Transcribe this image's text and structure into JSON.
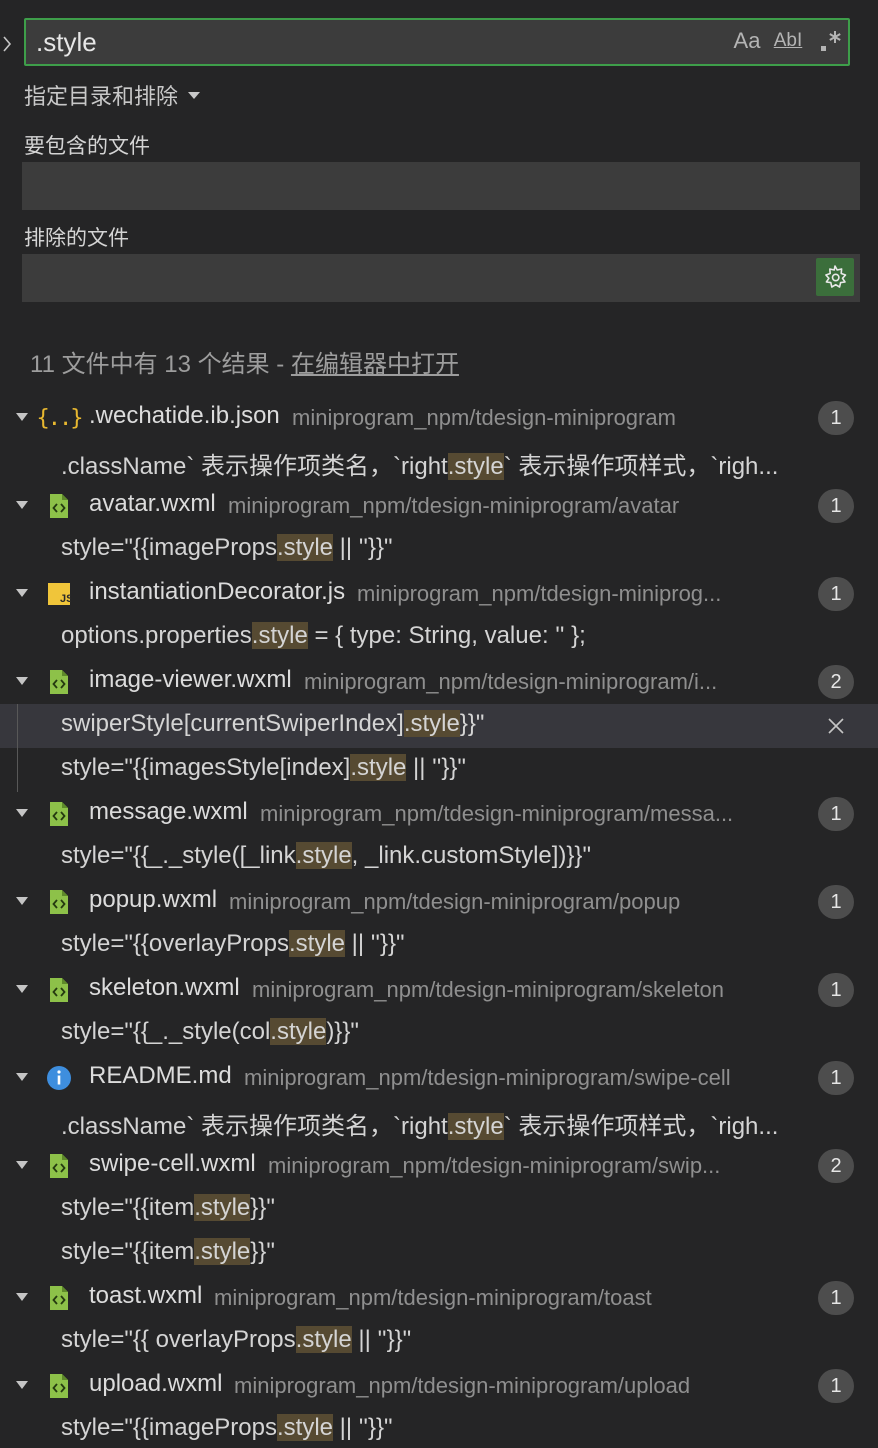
{
  "search": {
    "value": ".style",
    "match_case_label": "Aa",
    "whole_word_label": "AbI",
    "regex_label": ".*"
  },
  "details_toggle_label": "指定目录和排除",
  "include": {
    "label": "要包含的文件",
    "value": ""
  },
  "exclude": {
    "label": "排除的文件",
    "value": ""
  },
  "summary": {
    "text": "11 文件中有 13 个结果 - ",
    "link": "在编辑器中打开"
  },
  "colors": {
    "accent_border": "#3e9e4a",
    "match_highlight": "#564a32"
  },
  "results": [
    {
      "icon": "json-icon",
      "name": ".wechatide.ib.json",
      "path": "miniprogram_npm/tdesign-miniprogram",
      "count": "1",
      "matches": [
        {
          "pre": ".className` 表示操作项类名，`right",
          "hit": ".style",
          "post": "` 表示操作项样式，`righ..."
        }
      ]
    },
    {
      "icon": "wxml-icon",
      "name": "avatar.wxml",
      "path": "miniprogram_npm/tdesign-miniprogram/avatar",
      "count": "1",
      "matches": [
        {
          "pre": "style=\"{{imageProps",
          "hit": ".style",
          "post": " || ''}}\""
        }
      ]
    },
    {
      "icon": "js-icon",
      "name": "instantiationDecorator.js",
      "path": "miniprogram_npm/tdesign-miniprog...",
      "count": "1",
      "matches": [
        {
          "pre": "options.properties",
          "hit": ".style",
          "post": " = { type: String, value: '' };"
        }
      ]
    },
    {
      "icon": "wxml-icon",
      "name": "image-viewer.wxml",
      "path": "miniprogram_npm/tdesign-miniprogram/i...",
      "count": "2",
      "matches": [
        {
          "pre": "swiperStyle[currentSwiperIndex]",
          "hit": ".style",
          "post": "}}\"",
          "selected": true
        },
        {
          "pre": "style=\"{{imagesStyle[index]",
          "hit": ".style",
          "post": " || ''}}\""
        }
      ]
    },
    {
      "icon": "wxml-icon",
      "name": "message.wxml",
      "path": "miniprogram_npm/tdesign-miniprogram/messa...",
      "count": "1",
      "matches": [
        {
          "pre": "style=\"{{_._style([_link",
          "hit": ".style",
          "post": ", _link.customStyle])}}\""
        }
      ]
    },
    {
      "icon": "wxml-icon",
      "name": "popup.wxml",
      "path": "miniprogram_npm/tdesign-miniprogram/popup",
      "count": "1",
      "matches": [
        {
          "pre": "style=\"{{overlayProps",
          "hit": ".style",
          "post": " || ''}}\""
        }
      ]
    },
    {
      "icon": "wxml-icon",
      "name": "skeleton.wxml",
      "path": "miniprogram_npm/tdesign-miniprogram/skeleton",
      "count": "1",
      "matches": [
        {
          "pre": "style=\"{{_._style(col",
          "hit": ".style",
          "post": ")}}\""
        }
      ]
    },
    {
      "icon": "info-icon",
      "name": "README.md",
      "path": "miniprogram_npm/tdesign-miniprogram/swipe-cell",
      "count": "1",
      "matches": [
        {
          "pre": ".className` 表示操作项类名，`right",
          "hit": ".style",
          "post": "` 表示操作项样式，`righ..."
        }
      ]
    },
    {
      "icon": "wxml-icon",
      "name": "swipe-cell.wxml",
      "path": "miniprogram_npm/tdesign-miniprogram/swip...",
      "count": "2",
      "matches": [
        {
          "pre": "style=\"{{item",
          "hit": ".style",
          "post": "}}\""
        },
        {
          "pre": "style=\"{{item",
          "hit": ".style",
          "post": "}}\""
        }
      ]
    },
    {
      "icon": "wxml-icon",
      "name": "toast.wxml",
      "path": "miniprogram_npm/tdesign-miniprogram/toast",
      "count": "1",
      "matches": [
        {
          "pre": "style=\"{{ overlayProps",
          "hit": ".style",
          "post": " || ''}}\""
        }
      ]
    },
    {
      "icon": "wxml-icon",
      "name": "upload.wxml",
      "path": "miniprogram_npm/tdesign-miniprogram/upload",
      "count": "1",
      "matches": [
        {
          "pre": "style=\"{{imageProps",
          "hit": ".style",
          "post": " || ''}}\""
        }
      ]
    }
  ]
}
